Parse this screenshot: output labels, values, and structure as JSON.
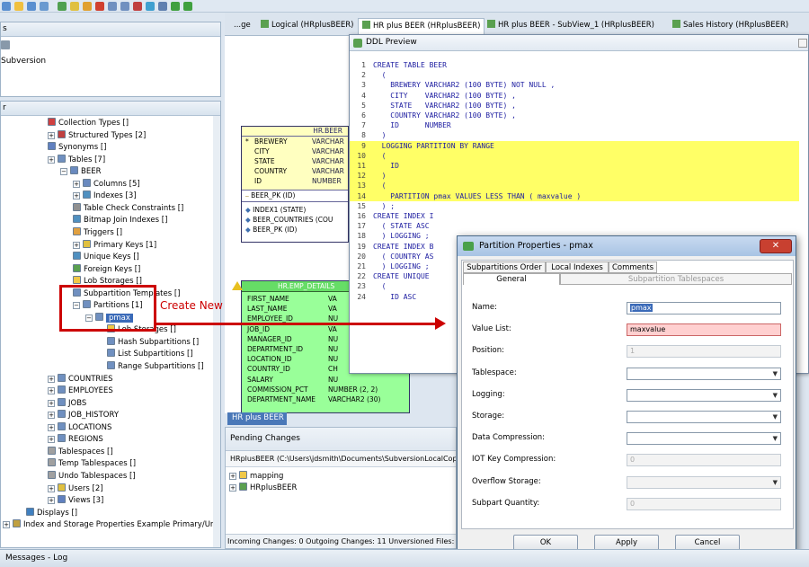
{
  "top_panel": {
    "title": "s",
    "item": "Subversion"
  },
  "tree_panel": {
    "title": "r",
    "rows": [
      {
        "label": "Collection Types []"
      },
      {
        "label": "Structured Types [2]"
      },
      {
        "label": "Synonyms []"
      },
      {
        "label": "Tables [7]"
      },
      {
        "label": "BEER"
      },
      {
        "label": "Columns [5]"
      },
      {
        "label": "Indexes [3]"
      },
      {
        "label": "Table Check Constraints []"
      },
      {
        "label": "Bitmap Join Indexes []"
      },
      {
        "label": "Triggers []"
      },
      {
        "label": "Primary Keys [1]"
      },
      {
        "label": "Unique Keys []"
      },
      {
        "label": "Foreign Keys []"
      },
      {
        "label": "Lob Storages []"
      },
      {
        "label": "Subpartition Templates []"
      },
      {
        "label": "Partitions [1]"
      },
      {
        "label": "pmax"
      },
      {
        "label": "Lob Storages []"
      },
      {
        "label": "Hash Subpartitions []"
      },
      {
        "label": "List Subpartitions []"
      },
      {
        "label": "Range Subpartitions []"
      },
      {
        "label": "COUNTRIES"
      },
      {
        "label": "EMPLOYEES"
      },
      {
        "label": "JOBS"
      },
      {
        "label": "JOB_HISTORY"
      },
      {
        "label": "LOCATIONS"
      },
      {
        "label": "REGIONS"
      },
      {
        "label": "Tablespaces []"
      },
      {
        "label": "Temp Tablespaces []"
      },
      {
        "label": "Undo Tablespaces []"
      },
      {
        "label": "Users [2]"
      },
      {
        "label": "Views [3]"
      },
      {
        "label": "Displays []"
      },
      {
        "label": "Index and Storage Properties Example Primary/Uniqu"
      }
    ]
  },
  "annotation": {
    "label": "Create New"
  },
  "tabs": [
    {
      "label": "...ge"
    },
    {
      "label": "Logical (HRplusBEER)"
    },
    {
      "label": "HR plus BEER (HRplusBEER)"
    },
    {
      "label": "HR plus BEER - SubView_1 (HRplusBEER)"
    },
    {
      "label": "Sales History (HRplusBEER)"
    }
  ],
  "diagram": {
    "beer_table": {
      "title": "HR.BEER",
      "columns": [
        {
          "marker": "*",
          "name": "BREWERY",
          "type": "VARCHAR"
        },
        {
          "marker": "",
          "name": "CITY",
          "type": "VARCHAR"
        },
        {
          "marker": "",
          "name": "STATE",
          "type": "VARCHAR"
        },
        {
          "marker": "",
          "name": "COUNTRY",
          "type": "VARCHAR"
        },
        {
          "marker": "",
          "name": "ID",
          "type": "NUMBER"
        }
      ],
      "pk": "BEER_PK (ID)",
      "indexes": [
        "INDEX1 (STATE)",
        "BEER_COUNTRIES (COU",
        "BEER_PK (ID)"
      ]
    },
    "emp_table": {
      "title": "HR.EMP_DETAILS",
      "columns": [
        {
          "name": "FIRST_NAME",
          "type": "VA"
        },
        {
          "name": "LAST_NAME",
          "type": "VA"
        },
        {
          "name": "EMPLOYEE_ID",
          "type": "NU"
        },
        {
          "name": "JOB_ID",
          "type": "VA"
        },
        {
          "name": "MANAGER_ID",
          "type": "NU"
        },
        {
          "name": "DEPARTMENT_ID",
          "type": "NU"
        },
        {
          "name": "LOCATION_ID",
          "type": "NU"
        },
        {
          "name": "COUNTRY_ID",
          "type": "CH"
        },
        {
          "name": "SALARY",
          "type": "NU"
        },
        {
          "name": "COMMISSION_PCT",
          "type": "NUMBER (2, 2)"
        },
        {
          "name": "DEPARTMENT_NAME",
          "type": "VARCHAR2 (30)"
        }
      ]
    },
    "tab_label": "HR plus BEER"
  },
  "ddl": {
    "title": "DDL Preview",
    "lines": [
      {
        "n": "1",
        "text": "CREATE TABLE BEER"
      },
      {
        "n": "2",
        "text": "  ("
      },
      {
        "n": "3",
        "text": "    BREWERY VARCHAR2 (100 BYTE) NOT NULL ,"
      },
      {
        "n": "4",
        "text": "    CITY    VARCHAR2 (100 BYTE) ,"
      },
      {
        "n": "5",
        "text": "    STATE   VARCHAR2 (100 BYTE) ,"
      },
      {
        "n": "6",
        "text": "    COUNTRY VARCHAR2 (100 BYTE) ,"
      },
      {
        "n": "7",
        "text": "    ID      NUMBER"
      },
      {
        "n": "8",
        "text": "  )"
      },
      {
        "n": "9",
        "text": "  LOGGING PARTITION BY RANGE"
      },
      {
        "n": "10",
        "text": "  ("
      },
      {
        "n": "11",
        "text": "    ID"
      },
      {
        "n": "12",
        "text": "  )"
      },
      {
        "n": "13",
        "text": "  ("
      },
      {
        "n": "14",
        "text": "    PARTITION pmax VALUES LESS THAN ( maxvalue )"
      },
      {
        "n": "15",
        "text": "  ) ;"
      },
      {
        "n": "16",
        "text": "CREATE INDEX I"
      },
      {
        "n": "17",
        "text": "  ( STATE ASC"
      },
      {
        "n": "18",
        "text": "  ) LOGGING ;"
      },
      {
        "n": "19",
        "text": "CREATE INDEX B"
      },
      {
        "n": "20",
        "text": "  ( COUNTRY AS"
      },
      {
        "n": "21",
        "text": "  ) LOGGING ;"
      },
      {
        "n": "22",
        "text": "CREATE UNIQUE"
      },
      {
        "n": "23",
        "text": "  ("
      },
      {
        "n": "24",
        "text": "    ID ASC"
      }
    ]
  },
  "dialog": {
    "title": "Partition Properties - pmax",
    "tabs_row1": [
      "Subpartitions Order",
      "Local Indexes",
      "Comments"
    ],
    "tabs_row2": [
      "General",
      "Subpartition Tablespaces"
    ],
    "fields": [
      {
        "label": "Name:",
        "value": ""
      },
      {
        "label": "Value List:",
        "value": ""
      },
      {
        "label": "Position:",
        "value": "1"
      },
      {
        "label": "Tablespace:",
        "value": ""
      },
      {
        "label": "Logging:",
        "value": ""
      },
      {
        "label": "Storage:",
        "value": ""
      },
      {
        "label": "Data Compression:",
        "value": ""
      },
      {
        "label": "IOT Key Compression:",
        "value": "0"
      },
      {
        "label": "Overflow Storage:",
        "value": ""
      },
      {
        "label": "Subpart Quantity:",
        "value": "0"
      }
    ],
    "name_value": "pmax",
    "value_list_value": "maxvalue",
    "buttons": {
      "ok": "OK",
      "apply": "Apply",
      "cancel": "Cancel"
    }
  },
  "pending": {
    "title": "Pending Changes",
    "path": "HRplusBEER (C:\\Users\\jdsmith\\Documents\\SubversionLocalCopy)",
    "items": [
      "mapping",
      "HRplusBEER"
    ],
    "status": "Incoming Changes: 0  Outgoing Changes: 11  Unversioned Files:"
  },
  "messages": {
    "title": "Messages - Log"
  },
  "colors": {
    "highlight_yellow": "#ffff66",
    "table_yellow": "#ffffc0",
    "table_green": "#99ff99",
    "red_annotation": "#cc0000"
  }
}
